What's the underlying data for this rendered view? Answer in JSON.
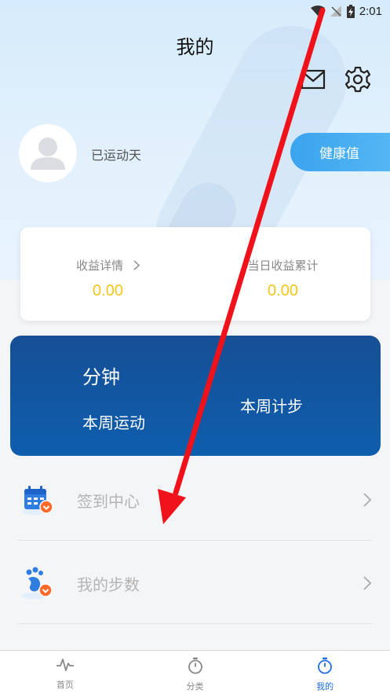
{
  "status_bar": {
    "time": "2:01",
    "icons": [
      "wifi-icon",
      "signal-off-icon",
      "battery-charging-icon"
    ]
  },
  "header": {
    "title": "我的",
    "icons": [
      "mail-icon",
      "gear-icon"
    ]
  },
  "profile": {
    "avatar_icon": "user-silhouette-icon",
    "text": "已运动天",
    "health_button": "健康值"
  },
  "earnings": {
    "details_label": "收益详情",
    "details_value": "0.00",
    "daily_label": "当日收益累计",
    "daily_value": "0.00"
  },
  "week_card": {
    "minutes_label": "分钟",
    "sport_label": "本周运动",
    "steps_label": "本周计步"
  },
  "menu": [
    {
      "label": "签到中心",
      "icon": "calendar-checkin-icon"
    },
    {
      "label": "我的步数",
      "icon": "footprints-icon"
    }
  ],
  "tabbar": {
    "tabs": [
      {
        "label": "首页",
        "icon": "pulse-icon",
        "active": false
      },
      {
        "label": "分类",
        "icon": "stopwatch-icon",
        "active": false
      },
      {
        "label": "我的",
        "icon": "stopwatch-icon",
        "active": true
      }
    ]
  },
  "colors": {
    "accent_blue": "#1f6fe0",
    "card_blue": "#164f95",
    "value_yellow": "#f3c61b",
    "health_button": "#3aa4ee",
    "annotation_arrow": "#f0121a"
  }
}
